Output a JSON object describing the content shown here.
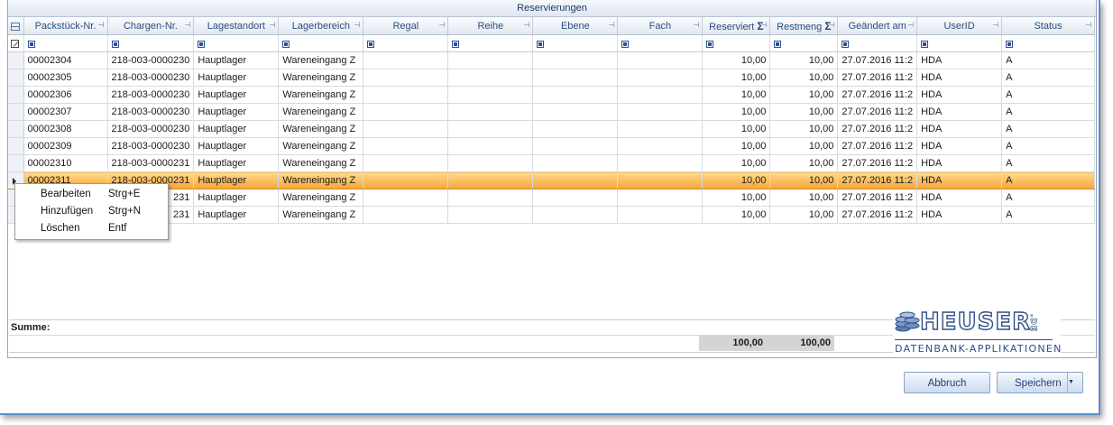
{
  "title": "Reservierungen",
  "columns": [
    {
      "label": "Packstück-Nr."
    },
    {
      "label": "Chargen-Nr."
    },
    {
      "label": "Lagestandort"
    },
    {
      "label": "Lagerbereich"
    },
    {
      "label": "Regal"
    },
    {
      "label": "Reihe"
    },
    {
      "label": "Ebene"
    },
    {
      "label": "Fach"
    },
    {
      "label": "Reserviert"
    },
    {
      "label": "Restmeng"
    },
    {
      "label": "Geändert am"
    },
    {
      "label": "UserID"
    },
    {
      "label": "Status"
    }
  ],
  "rows": [
    [
      "00002304",
      "218-003-0000230",
      "Hauptlager",
      "Wareneingang Z",
      "",
      "",
      "",
      "",
      "10,00",
      "10,00",
      "27.07.2016 11:2",
      "HDA",
      "A"
    ],
    [
      "00002305",
      "218-003-0000230",
      "Hauptlager",
      "Wareneingang Z",
      "",
      "",
      "",
      "",
      "10,00",
      "10,00",
      "27.07.2016 11:2",
      "HDA",
      "A"
    ],
    [
      "00002306",
      "218-003-0000230",
      "Hauptlager",
      "Wareneingang Z",
      "",
      "",
      "",
      "",
      "10,00",
      "10,00",
      "27.07.2016 11:2",
      "HDA",
      "A"
    ],
    [
      "00002307",
      "218-003-0000230",
      "Hauptlager",
      "Wareneingang Z",
      "",
      "",
      "",
      "",
      "10,00",
      "10,00",
      "27.07.2016 11:2",
      "HDA",
      "A"
    ],
    [
      "00002308",
      "218-003-0000230",
      "Hauptlager",
      "Wareneingang Z",
      "",
      "",
      "",
      "",
      "10,00",
      "10,00",
      "27.07.2016 11:2",
      "HDA",
      "A"
    ],
    [
      "00002309",
      "218-003-0000230",
      "Hauptlager",
      "Wareneingang Z",
      "",
      "",
      "",
      "",
      "10,00",
      "10,00",
      "27.07.2016 11:2",
      "HDA",
      "A"
    ],
    [
      "00002310",
      "218-003-0000231",
      "Hauptlager",
      "Wareneingang Z",
      "",
      "",
      "",
      "",
      "10,00",
      "10,00",
      "27.07.2016 11:2",
      "HDA",
      "A"
    ],
    [
      "00002311",
      "218-003-0000231",
      "Hauptlager",
      "Wareneingang Z",
      "",
      "",
      "",
      "",
      "10,00",
      "10,00",
      "27.07.2016 11:2",
      "HDA",
      "A"
    ],
    [
      "",
      "231",
      "Hauptlager",
      "Wareneingang Z",
      "",
      "",
      "",
      "",
      "10,00",
      "10,00",
      "27.07.2016 11:2",
      "HDA",
      "A"
    ],
    [
      "",
      "231",
      "Hauptlager",
      "Wareneingang Z",
      "",
      "",
      "",
      "",
      "10,00",
      "10,00",
      "27.07.2016 11:2",
      "HDA",
      "A"
    ]
  ],
  "selected_row_index": 7,
  "summary": {
    "label": "Summe:",
    "reserviert_total": "100,00",
    "restmeng_total": "100,00"
  },
  "context_menu": [
    {
      "label": "Bearbeiten",
      "shortcut": "Strg+E"
    },
    {
      "label": "Hinzufügen",
      "shortcut": "Strg+N"
    },
    {
      "label": "Löschen",
      "shortcut": "Entf"
    }
  ],
  "logo": {
    "brand": "HEUSER",
    "suffix": ".DE",
    "tagline": "DATENBANK-APPLIKATIONEN"
  },
  "buttons": {
    "cancel": "Abbruch",
    "save": "Speichern"
  },
  "colors": {
    "selection": "#f6a53a",
    "header_text": "#2a4d80",
    "button_text": "#1e3f75",
    "window_border": "#5a8ccf"
  },
  "icons": {
    "pin": "pin-icon",
    "sum": "sigma-icon",
    "filter": "filter-checkbox-icon",
    "column_chooser": "column-chooser-icon",
    "edit_filter": "edit-filter-icon",
    "row_pointer": "row-pointer-icon",
    "dropdown": "chevron-down-icon"
  }
}
